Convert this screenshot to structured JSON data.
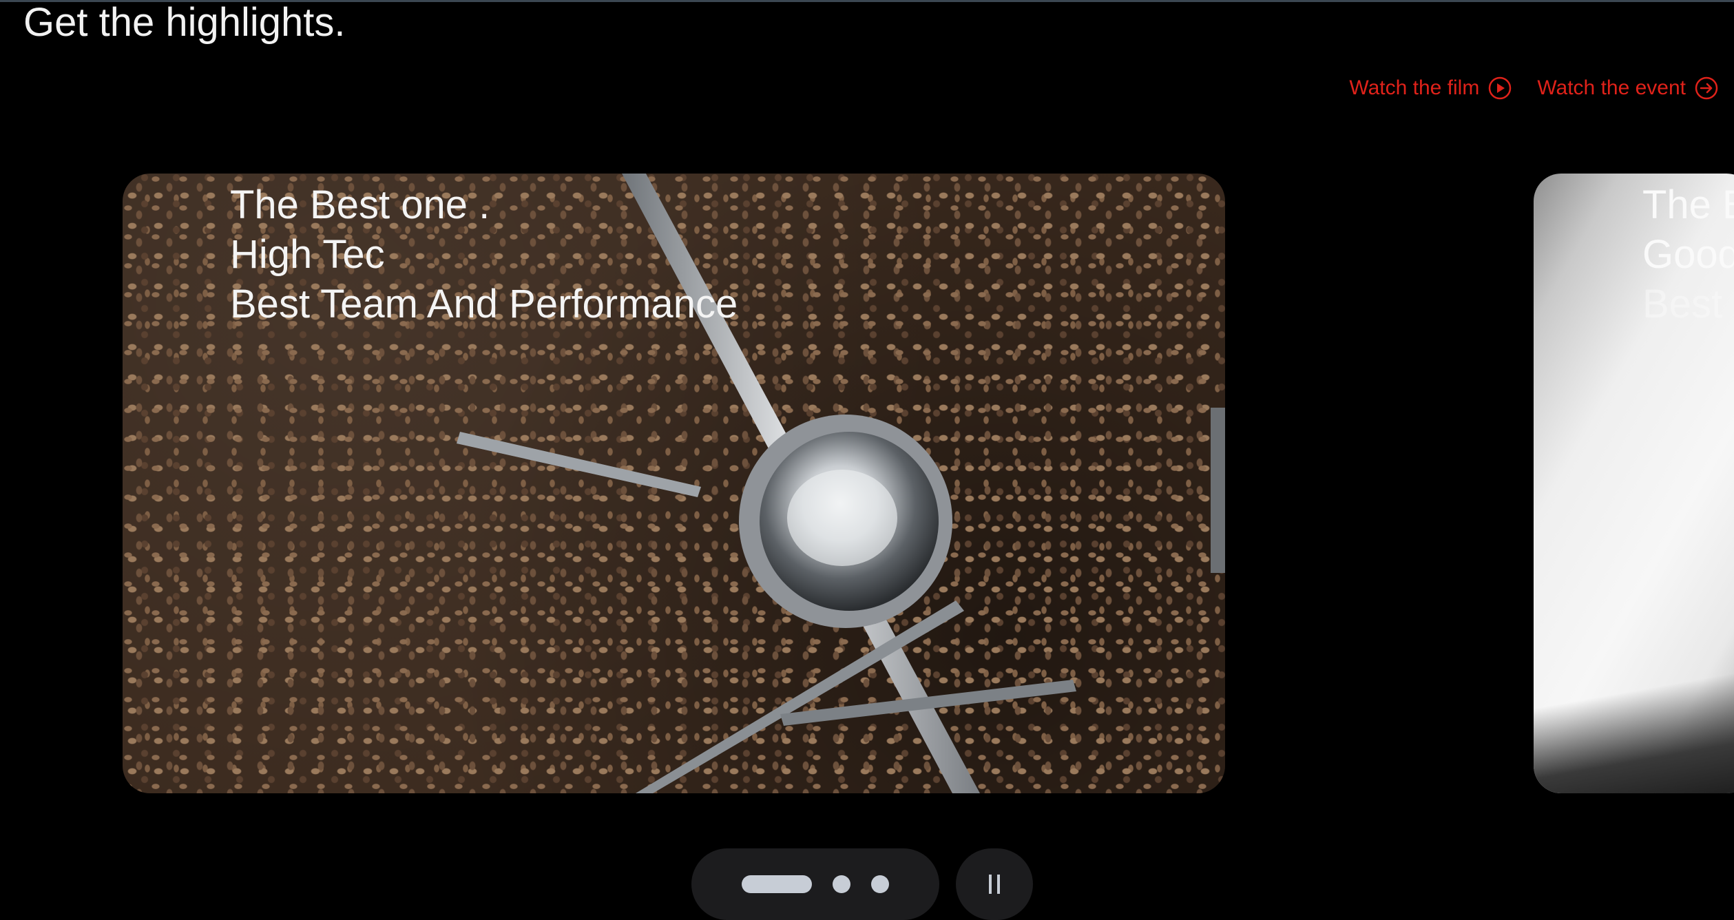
{
  "header": {
    "title": "Get the highlights."
  },
  "links": [
    {
      "label": "Watch the film",
      "icon": "play-circle-icon"
    },
    {
      "label": "Watch the event",
      "icon": "arrow-right-circle-icon"
    }
  ],
  "slides": [
    {
      "lines": [
        "The Best one .",
        "High Tec",
        "Best Team And Performance"
      ]
    },
    {
      "lines": [
        "The B",
        "Good",
        "Best"
      ]
    }
  ],
  "carousel": {
    "active_index": 0,
    "dot_count": 3,
    "pause_icon": "pause-icon"
  },
  "colors": {
    "background": "#000000",
    "link": "#e0221a",
    "control_bg": "#1c1c1e",
    "control_fg": "#c7cdd6"
  }
}
